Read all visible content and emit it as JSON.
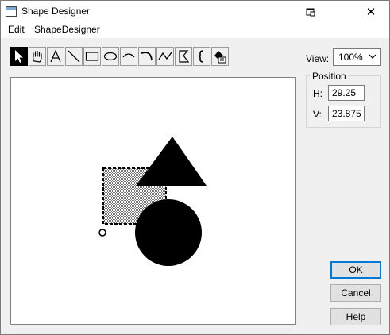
{
  "window": {
    "title": "Shape Designer",
    "help_icon": "help-context-icon",
    "close_glyph": "✕"
  },
  "menu": {
    "items": [
      {
        "label": "Edit"
      },
      {
        "label": "ShapeDesigner"
      }
    ]
  },
  "toolbar": {
    "tools": [
      {
        "name": "pointer-tool",
        "icon": "arrow-pointer",
        "active": true
      },
      {
        "name": "pan-tool",
        "icon": "hand"
      },
      {
        "name": "text-tool",
        "icon": "letter-A"
      },
      {
        "name": "line-tool",
        "icon": "line"
      },
      {
        "name": "rectangle-tool",
        "icon": "rectangle"
      },
      {
        "name": "ellipse-tool",
        "icon": "ellipse"
      },
      {
        "name": "arc-tool",
        "icon": "arc"
      },
      {
        "name": "curve-tool",
        "icon": "curve"
      },
      {
        "name": "polyline-tool",
        "icon": "polyline"
      },
      {
        "name": "polygon-tool",
        "icon": "polygon"
      },
      {
        "name": "bracket-tool",
        "icon": "brace"
      },
      {
        "name": "fill-tool",
        "icon": "paint-bucket"
      }
    ]
  },
  "view": {
    "label": "View:",
    "zoom": "100%"
  },
  "position": {
    "title": "Position",
    "h_label": "H:",
    "h_value": "29.25",
    "v_label": "V:",
    "v_value": "23.875"
  },
  "buttons": {
    "ok": "OK",
    "cancel": "Cancel",
    "help": "Help"
  },
  "colors": {
    "accent": "#0078d7",
    "shape_fill": "#000000",
    "window_bg": "#f0f0f0"
  }
}
